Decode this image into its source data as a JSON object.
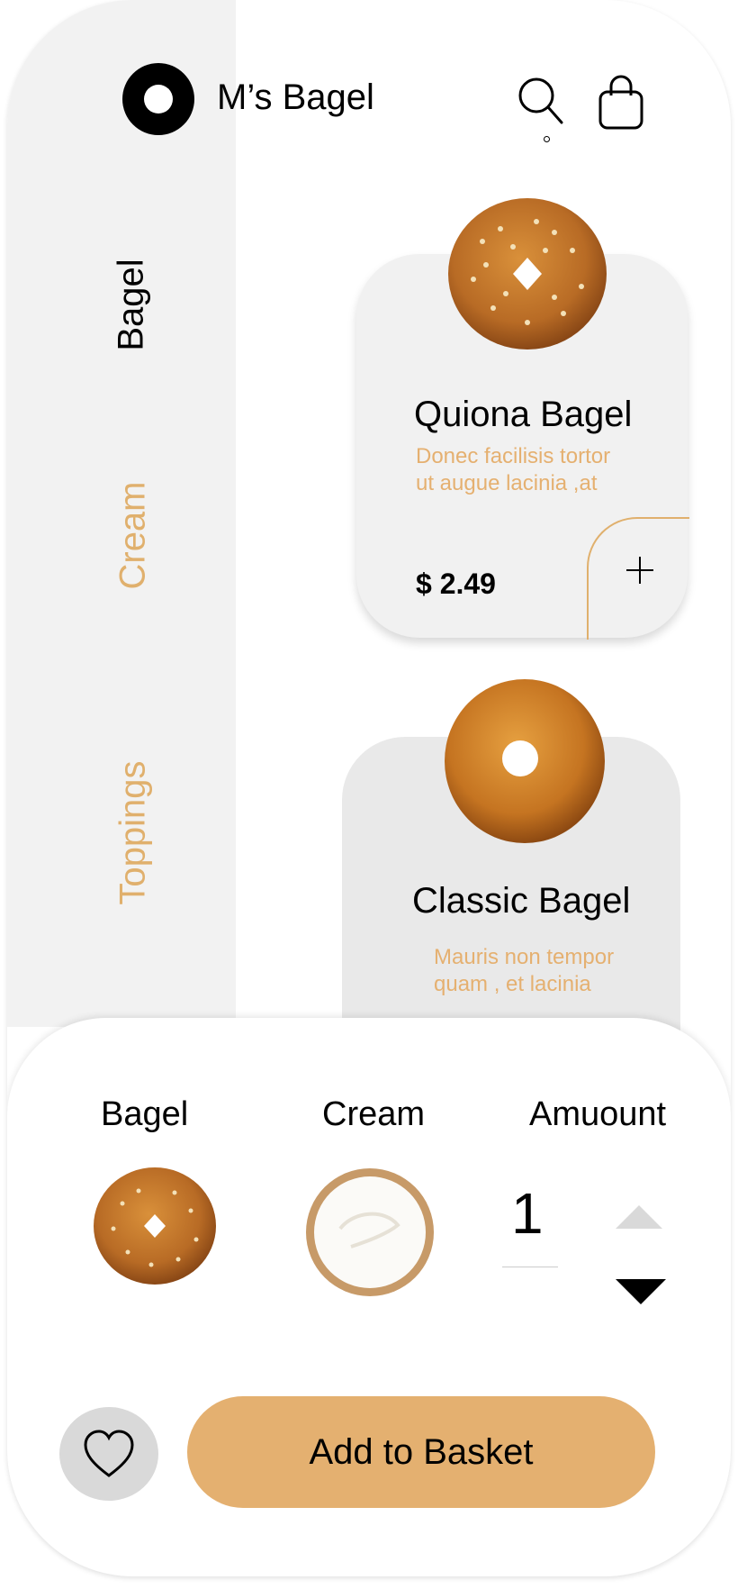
{
  "header": {
    "brand": "M’s Bagel",
    "icons": [
      "logo",
      "search-icon",
      "shopping-bag-icon"
    ]
  },
  "categories": [
    {
      "label": "Bagel",
      "active": true
    },
    {
      "label": "Cream",
      "active": false
    },
    {
      "label": "Toppings",
      "active": false
    }
  ],
  "products": [
    {
      "title": "Quiona Bagel",
      "desc_line1": "Donec facilisis tortor",
      "desc_line2": "ut augue lacinia ,at",
      "price": "$ 2.49"
    },
    {
      "title": "Classic Bagel",
      "desc_line1": "Mauris non tempor",
      "desc_line2": "quam , et lacinia"
    }
  ],
  "builder": {
    "bagel_label": "Bagel",
    "cream_label": "Cream",
    "amount_label": "Amuount",
    "amount_value": "1"
  },
  "actions": {
    "favorite_icon": "heart-icon",
    "add_to_basket": "Add to Basket"
  },
  "colors": {
    "accent": "#e4b070",
    "accent_text": "#e5b070",
    "sidebar_bg": "#f2f2f2"
  }
}
